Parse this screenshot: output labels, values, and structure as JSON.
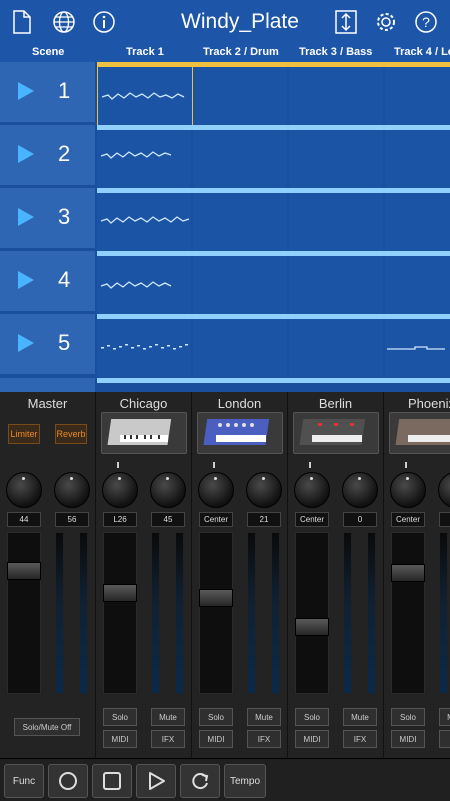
{
  "header": {
    "title": "Windy_Plate",
    "icons": [
      "file-icon",
      "globe-icon",
      "info-icon",
      "resize-vertical-icon",
      "gear-icon",
      "help-icon"
    ]
  },
  "columns": [
    "Scene",
    "Track 1",
    "Track 2 / Drum",
    "Track 3 / Bass",
    "Track 4 / Le"
  ],
  "scenes": [
    "1",
    "2",
    "3",
    "4",
    "5"
  ],
  "mixer": {
    "master": {
      "name": "Master",
      "limiter": "Limiter",
      "reverb": "Reverb",
      "values": [
        "44",
        "56"
      ],
      "solo_mute_off": "Solo/Mute Off"
    },
    "strips": [
      {
        "name": "Chicago",
        "pan": "L26",
        "send": "45",
        "solo": "Solo",
        "mute": "Mute",
        "midi": "MIDI",
        "ifx": "IFX"
      },
      {
        "name": "London",
        "pan": "Center",
        "send": "21",
        "solo": "Solo",
        "mute": "Mute",
        "midi": "MIDI",
        "ifx": "IFX"
      },
      {
        "name": "Berlin",
        "pan": "Center",
        "send": "0",
        "solo": "Solo",
        "mute": "Mute",
        "midi": "MIDI",
        "ifx": "IFX"
      },
      {
        "name": "Phoenix",
        "pan": "Center",
        "send": "",
        "solo": "Solo",
        "mute": "Mute",
        "midi": "MIDI",
        "ifx": "IFX"
      }
    ]
  },
  "transport": {
    "func": "Func",
    "tempo": "Tempo"
  },
  "colors": {
    "header_blue": "#1d56a8",
    "playing_accent": "#f0c040",
    "play_icon": "#49b4ff"
  }
}
